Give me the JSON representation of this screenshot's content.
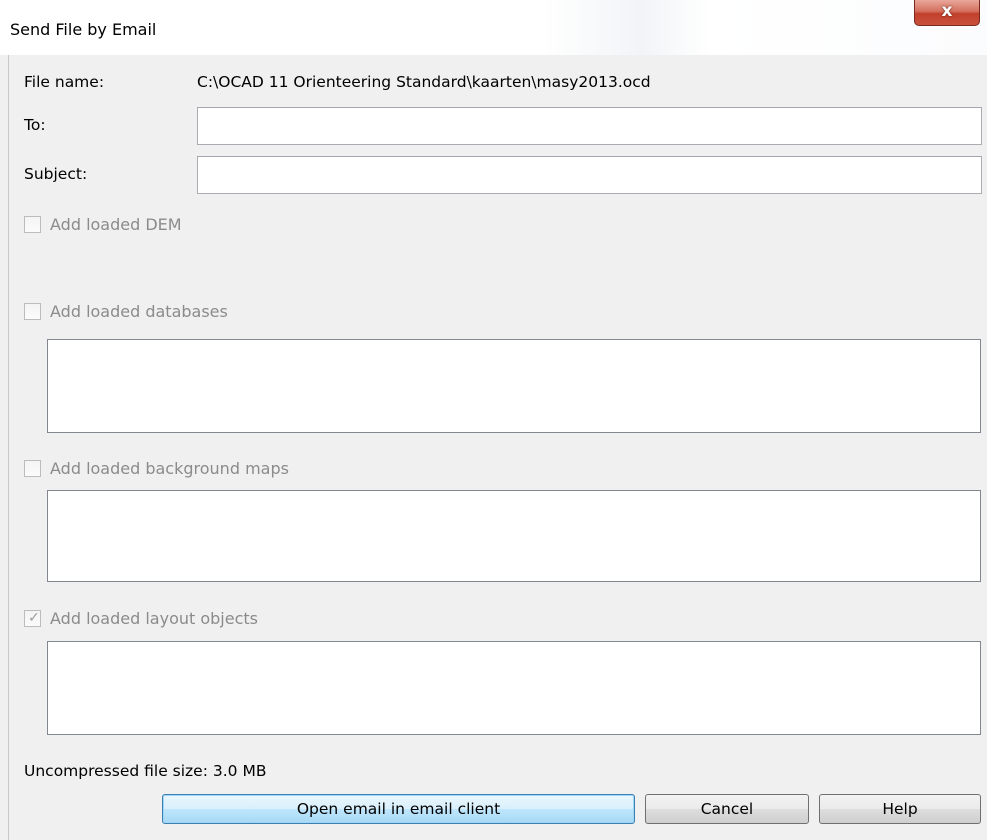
{
  "window": {
    "title": "Send File by Email",
    "close_glyph": "x"
  },
  "form": {
    "file_name_label": "File name:",
    "file_name_value": "C:\\OCAD 11 Orienteering Standard\\kaarten\\masy2013.ocd",
    "to_label": "To:",
    "to_value": "",
    "subject_label": "Subject:",
    "subject_value": ""
  },
  "options": {
    "dem": {
      "label": "Add loaded DEM",
      "checked": false,
      "enabled": false
    },
    "databases": {
      "label": "Add loaded databases",
      "checked": false,
      "enabled": false
    },
    "background_maps": {
      "label": "Add loaded background maps",
      "checked": false,
      "enabled": false
    },
    "layout_objects": {
      "label": "Add loaded layout objects",
      "checked": true,
      "enabled": false,
      "check_glyph": "✓"
    }
  },
  "footer": {
    "file_size_text": "Uncompressed file size: 3.0 MB"
  },
  "buttons": {
    "open_email": "Open email in email client",
    "cancel": "Cancel",
    "help": "Help"
  },
  "colors": {
    "disabled_text": "#8b8b8b",
    "close_button": "#c2402b",
    "default_button_border": "#3c7fb1"
  }
}
